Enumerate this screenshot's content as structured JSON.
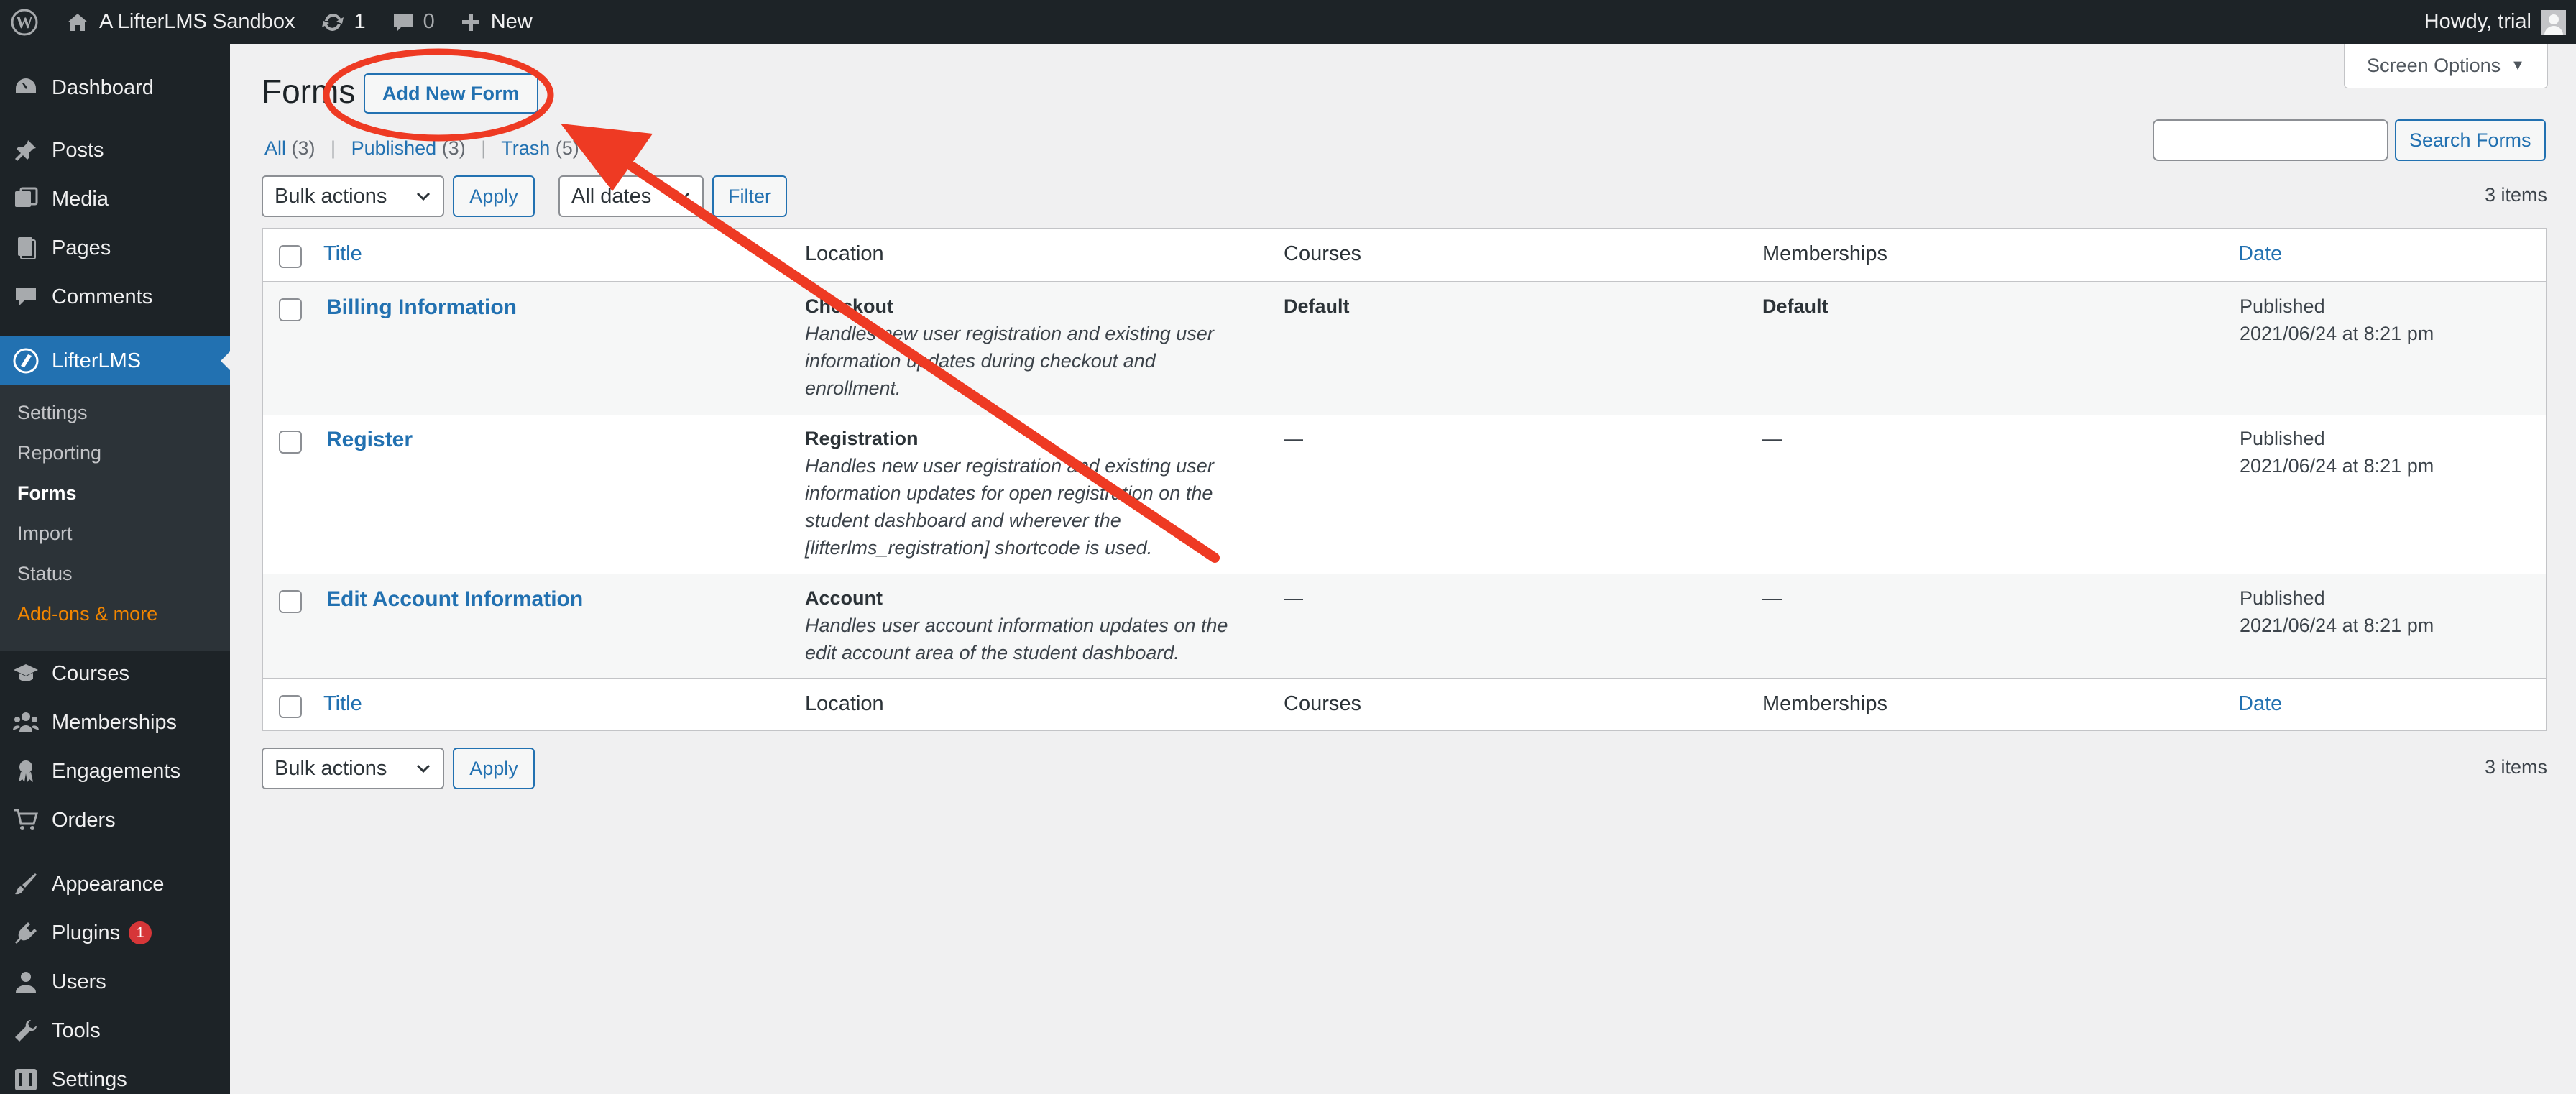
{
  "admin_bar": {
    "site_name": "A LifterLMS Sandbox",
    "updates_count": "1",
    "comments_count": "0",
    "new_label": "New",
    "howdy": "Howdy, trial"
  },
  "sidebar": {
    "dashboard": "Dashboard",
    "posts": "Posts",
    "media": "Media",
    "pages": "Pages",
    "comments": "Comments",
    "lifterlms": "LifterLMS",
    "submenu": {
      "settings": "Settings",
      "reporting": "Reporting",
      "forms": "Forms",
      "import": "Import",
      "status": "Status",
      "addons": "Add-ons & more"
    },
    "courses": "Courses",
    "memberships": "Memberships",
    "engagements": "Engagements",
    "orders": "Orders",
    "appearance": "Appearance",
    "plugins": "Plugins",
    "plugins_badge": "1",
    "users": "Users",
    "tools": "Tools",
    "settings": "Settings"
  },
  "screen_options": "Screen Options",
  "page": {
    "title": "Forms",
    "add_new": "Add New Form"
  },
  "filters": {
    "all": "All",
    "all_count": "(3)",
    "published": "Published",
    "published_count": "(3)",
    "trash": "Trash",
    "trash_count": "(5)"
  },
  "search": {
    "placeholder": "",
    "button": "Search Forms"
  },
  "toolbar": {
    "bulk_actions": "Bulk actions",
    "apply": "Apply",
    "all_dates": "All dates",
    "filter": "Filter",
    "items_count": "3 items"
  },
  "table": {
    "headers": {
      "title": "Title",
      "location": "Location",
      "courses": "Courses",
      "memberships": "Memberships",
      "date": "Date"
    },
    "rows": [
      {
        "title": "Billing Information",
        "location": "Checkout",
        "desc_1": "Handles new user registration and existing user",
        "desc_2": "information updates during checkout and",
        "desc_3": "enrollment.",
        "desc_4": "",
        "courses": "Default",
        "memberships": "Default",
        "status": "Published",
        "date": "2021/06/24 at 8:21 pm"
      },
      {
        "title": "Register",
        "location": "Registration",
        "desc_1": "Handles new user registration and existing user",
        "desc_2": "information updates for open registration on the",
        "desc_3": "student dashboard and wherever the",
        "desc_4": "[lifterlms_registration] shortcode is used.",
        "courses": "—",
        "memberships": "—",
        "status": "Published",
        "date": "2021/06/24 at 8:21 pm"
      },
      {
        "title": "Edit Account Information",
        "location": "Account",
        "desc_1": "Handles user account information updates on the",
        "desc_2": "edit account area of the student dashboard.",
        "desc_3": "",
        "desc_4": "",
        "courses": "—",
        "memberships": "—",
        "status": "Published",
        "date": "2021/06/24 at 8:21 pm"
      }
    ]
  },
  "colors": {
    "annotation_red": "#ee3a23",
    "wp_blue": "#2271b1",
    "admin_dark": "#1d2327"
  }
}
